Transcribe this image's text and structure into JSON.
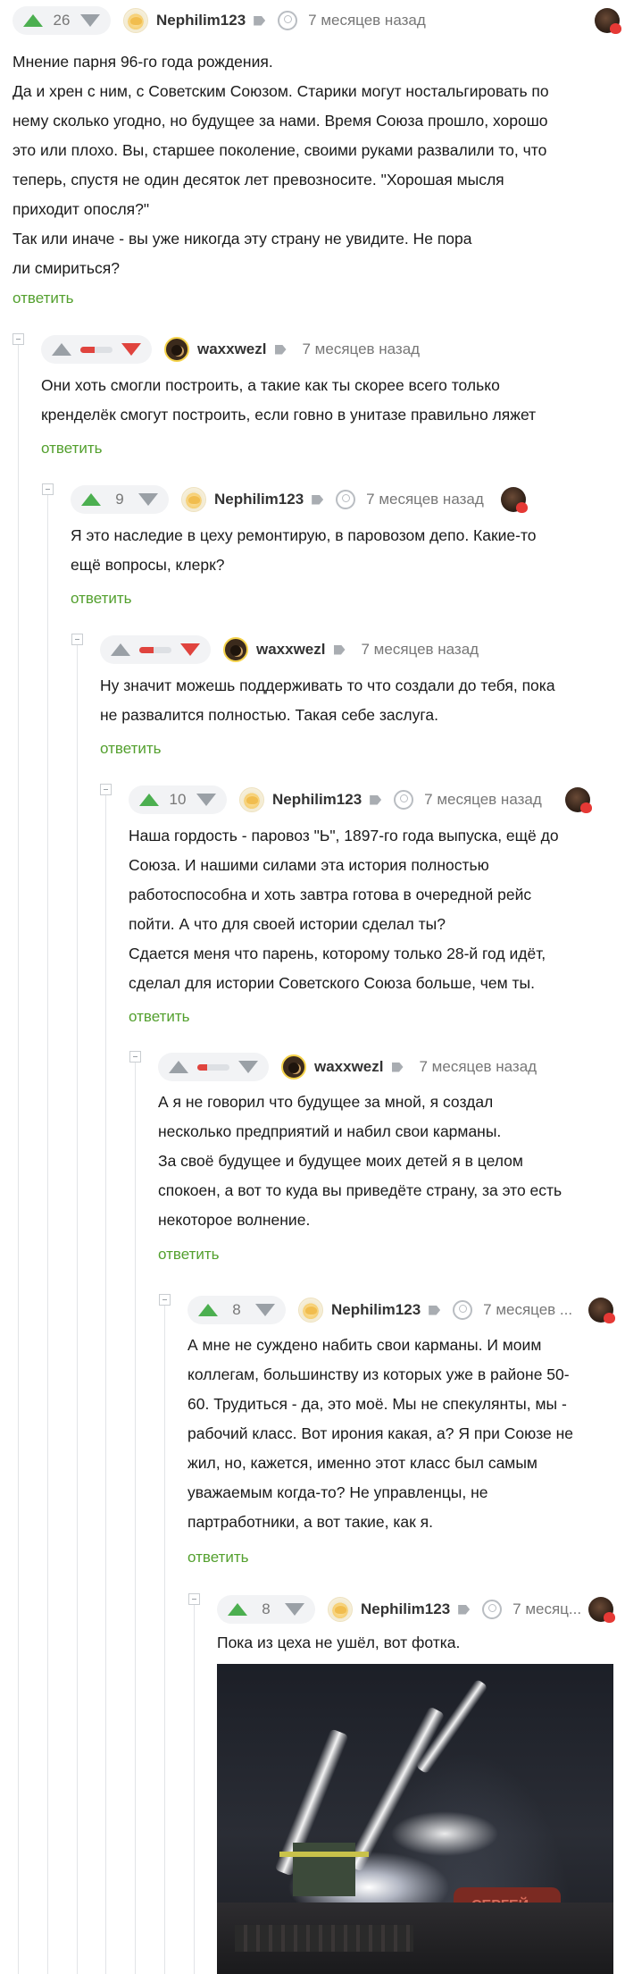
{
  "comments": [
    {
      "rating": "26",
      "user": "Nephilim123",
      "time": "7 месяцев назад",
      "text": [
        "Мнение парня 96-го года рождения.",
        "Да и хрен с ним, с Советским Союзом. Старики могут ностальгировать по",
        "нему сколько угодно, но будущее за нами. Время Союза прошло, хорошо",
        "это или плохо. Вы, старшее поколение, своими руками развалили то, что",
        "теперь, спустя не один десяток лет превозносите. \"Хорошая мысля",
        "приходит опосля?\"",
        "Так или иначе - вы уже никогда эту страну не увидите. Не пора",
        "ли смириться?"
      ],
      "reply": "ответить"
    },
    {
      "user": "waxxwezl",
      "time": "7 месяцев назад",
      "text": [
        "Они хоть смогли построить, а такие как ты скорее всего только",
        "кренделёк смогут построить, если говно в унитазе правильно ляжет"
      ],
      "reply": "ответить"
    },
    {
      "rating": "9",
      "user": "Nephilim123",
      "time": "7 месяцев назад",
      "text": [
        "Я это наследие в цеху ремонтирую, в паровозом депо. Какие-то",
        "ещё вопросы, клерк?"
      ],
      "reply": "ответить"
    },
    {
      "user": "waxxwezl",
      "time": "7 месяцев назад",
      "text": [
        "Ну значит можешь поддерживать то что создали до тебя, пока",
        "не развалится полностью. Такая себе заслуга."
      ],
      "reply": "ответить"
    },
    {
      "rating": "10",
      "user": "Nephilim123",
      "time": "7 месяцев назад",
      "text": [
        "Наша гордость - паровоз \"Ь\", 1897-го года выпуска, ещё до",
        "Союза. И нашими силами эта история полностью",
        "работоспособна и хоть завтра готова в очередной рейс",
        "пойти. А что для своей истории сделал ты?",
        "Сдается меня что парень, которому только 28-й год идёт,",
        "сделал для истории Советского Союза больше, чем ты."
      ],
      "reply": "ответить"
    },
    {
      "user": "waxxwezl",
      "time": "7 месяцев назад",
      "text": [
        "А я не говорил что будущее за мной, я создал",
        "несколько предприятий и набил свои карманы.",
        "За своё будущее и будущее моих детей я в целом",
        "спокоен, а вот то куда вы приведёте страну, за это есть",
        "некоторое волнение."
      ],
      "reply": "ответить"
    },
    {
      "rating": "8",
      "user": "Nephilim123",
      "time": "7 месяцев ...",
      "text": [
        "А мне не суждено набить свои карманы. И моим",
        "коллегам, большинству из которых уже в районе 50-",
        "60. Трудиться - да, это моё. Мы не спекулянты, мы -",
        "рабочий класс. Вот ирония какая, а? Я при Союзе не",
        "жил, но, кажется, именно этот класс был самым",
        "уважаемым когда-то? Не управленцы, не",
        "партработники, а вот такие, как я."
      ],
      "reply": "ответить"
    },
    {
      "rating": "8",
      "user": "Nephilim123",
      "time": "7 месяц...",
      "text": [
        "Пока из цеха не ушёл, вот фотка."
      ]
    }
  ],
  "photo_text": "СЕРГЕЙ"
}
